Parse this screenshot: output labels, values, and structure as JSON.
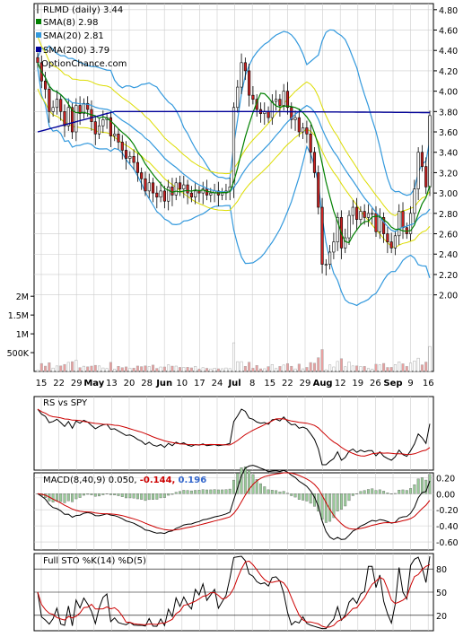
{
  "chart_data": [
    {
      "type": "candlestick",
      "panel": "price",
      "title": "RLMD (daily) 3.44",
      "watermark": "OptionChance.com",
      "legend_position": "top-left",
      "y_ticks": [
        "4.80",
        "4.60",
        "4.40",
        "4.20",
        "4.00",
        "3.80",
        "3.60",
        "3.40",
        "3.20",
        "3.00",
        "2.80",
        "2.60",
        "2.40",
        "2.20",
        "2.00"
      ],
      "ylim": [
        1.9,
        4.86
      ],
      "x_tick_labels": [
        "15",
        "22",
        "29",
        "May",
        "13",
        "20",
        "28",
        "Jun",
        "10",
        "17",
        "24",
        "Jul",
        "8",
        "15",
        "22",
        "29",
        "Aug",
        "12",
        "19",
        "26",
        "Sep",
        "9",
        "16"
      ],
      "x_ticks_bold": [
        "May",
        "Jun",
        "Jul",
        "Aug",
        "Sep"
      ],
      "series": [
        {
          "name": "SMA(8)",
          "value": "2.98",
          "color": "#008000"
        },
        {
          "name": "SMA(20)",
          "value": "2.81",
          "color": "#3399dd"
        },
        {
          "name": "SMA(200)",
          "value": "3.79",
          "color": "#000099"
        }
      ],
      "close": [
        4.28,
        4.1,
        4.02,
        3.8,
        3.84,
        3.92,
        3.8,
        3.66,
        3.84,
        3.6,
        3.86,
        3.78,
        3.88,
        3.82,
        3.7,
        3.58,
        3.66,
        3.72,
        3.74,
        3.56,
        3.58,
        3.5,
        3.42,
        3.34,
        3.36,
        3.3,
        3.2,
        3.14,
        3.02,
        3.1,
        3.0,
        2.96,
        3.02,
        2.92,
        3.06,
        2.98,
        3.1,
        3.04,
        3.08,
        3.0,
        2.96,
        3.02,
        3.0,
        3.04,
        2.98,
        3.0,
        3.02,
        2.98,
        3.0,
        3.02,
        3.06,
        3.84,
        4.04,
        4.28,
        4.2,
        3.96,
        3.92,
        3.82,
        3.78,
        3.8,
        3.74,
        3.9,
        3.92,
        3.86,
        4.0,
        3.84,
        3.72,
        3.74,
        3.6,
        3.64,
        3.58,
        3.4,
        3.2,
        2.86,
        2.3,
        2.3,
        2.42,
        2.52,
        2.76,
        2.46,
        2.56,
        2.78,
        2.86,
        2.74,
        2.82,
        2.76,
        2.8,
        2.8,
        2.62,
        2.76,
        2.6,
        2.52,
        2.46,
        2.58,
        2.82,
        2.66,
        2.6,
        2.8,
        3.04,
        3.4,
        3.26,
        3.06,
        3.76
      ],
      "high_low_note": "daily OHLC candles with wicks",
      "volume_ticks": [
        "2M",
        "1.5M",
        "1M",
        "500K"
      ]
    },
    {
      "type": "line",
      "panel": "rs",
      "title": "RS vs SPY",
      "series": [
        {
          "name": "RS",
          "color": "#000000"
        },
        {
          "name": "RS MA",
          "color": "#cc0000"
        }
      ]
    },
    {
      "type": "line",
      "panel": "macd",
      "title": "MACD(8,40,9) 0.050, -0.144, 0.196",
      "values": {
        "macd": "0.050",
        "signal": "-0.144",
        "hist": "0.196"
      },
      "y_ticks": [
        "0.20",
        "0.00",
        "-0.20",
        "-0.40",
        "-0.60"
      ],
      "ylim": [
        -0.7,
        0.26
      ]
    },
    {
      "type": "line",
      "panel": "stochastic",
      "title": "Full STO %K(14) %D(5)",
      "y_ticks": [
        "80",
        "50",
        "20"
      ],
      "ylim": [
        0,
        100
      ]
    }
  ],
  "labels": {
    "title": "RLMD (daily) 3.44",
    "sma8": "SMA(8) 2.98",
    "sma20": "SMA(20) 2.81",
    "sma200": "SMA(200) 3.79",
    "watermark": "OptionChance.com",
    "rs": "RS vs SPY",
    "macd_prefix": "MACD(8,40,9) 0.050,",
    "macd_signal": "-0.144,",
    "macd_hist": "0.196",
    "sto": "Full STO %K(14) %D(5)"
  },
  "colors": {
    "up": "#ffffff",
    "down": "#cc2222",
    "bollinger": "#3399dd",
    "envelope": "#dddd00",
    "sma8": "#008000",
    "sma200": "#000099",
    "rs": "#000000",
    "rs_ma": "#cc0000",
    "volume": "#e8a0a0",
    "grid": "#cccccc"
  }
}
